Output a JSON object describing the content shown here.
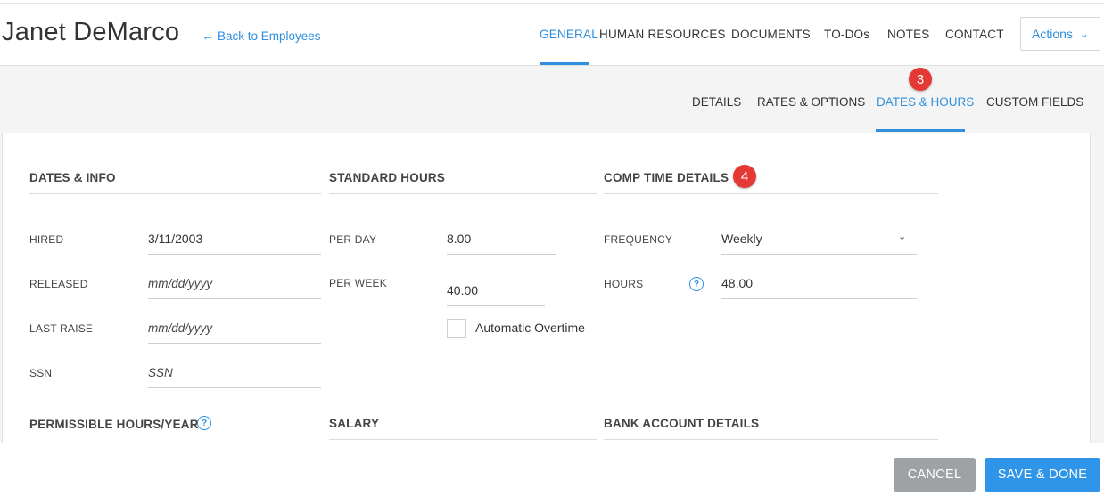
{
  "header": {
    "employee_name": "Janet DeMarco",
    "back_link": "Back to Employees",
    "tabs": [
      {
        "label": "GENERAL",
        "active": true
      },
      {
        "label": "HUMAN RESOURCES",
        "active": false
      },
      {
        "label": "DOCUMENTS",
        "active": false
      },
      {
        "label": "TO-DOs",
        "active": false
      },
      {
        "label": "NOTES",
        "active": false
      },
      {
        "label": "CONTACT",
        "active": false
      }
    ],
    "actions_label": "Actions"
  },
  "subtabs": [
    {
      "label": "DETAILS",
      "active": false
    },
    {
      "label": "RATES & OPTIONS",
      "active": false
    },
    {
      "label": "DATES & HOURS",
      "active": true
    },
    {
      "label": "CUSTOM FIELDS",
      "active": false
    }
  ],
  "badges": {
    "step3": "3",
    "step4": "4"
  },
  "sections": {
    "dates_info": {
      "title": "DATES & INFO",
      "fields": [
        {
          "label": "HIRED",
          "value": "3/11/2003"
        },
        {
          "label": "RELEASED",
          "placeholder": "mm/dd/yyyy"
        },
        {
          "label": "LAST RAISE",
          "placeholder": "mm/dd/yyyy"
        },
        {
          "label": "SSN",
          "placeholder": "SSN"
        }
      ]
    },
    "standard_hours": {
      "title": "STANDARD HOURS",
      "per_day_label": "PER DAY",
      "per_day_value": "8.00",
      "per_week_label": "PER WEEK",
      "per_week_value": "40.00",
      "auto_overtime_label": "Automatic Overtime",
      "auto_overtime_checked": false
    },
    "comp_time": {
      "title": "COMP TIME DETAILS",
      "frequency_label": "FREQUENCY",
      "frequency_value": "Weekly",
      "hours_label": "HOURS",
      "hours_value": "48.00"
    },
    "permissible_hours": {
      "title": "PERMISSIBLE HOURS/YEAR"
    },
    "salary": {
      "title": "SALARY"
    },
    "bank_account": {
      "title": "BANK ACCOUNT DETAILS"
    }
  },
  "footer": {
    "cancel_label": "CANCEL",
    "save_label": "SAVE & DONE"
  },
  "colors": {
    "accent": "#2f8fde",
    "badge": "#e53935",
    "cancel_button": "#9ea2a5",
    "save_button": "#2f95e8"
  }
}
